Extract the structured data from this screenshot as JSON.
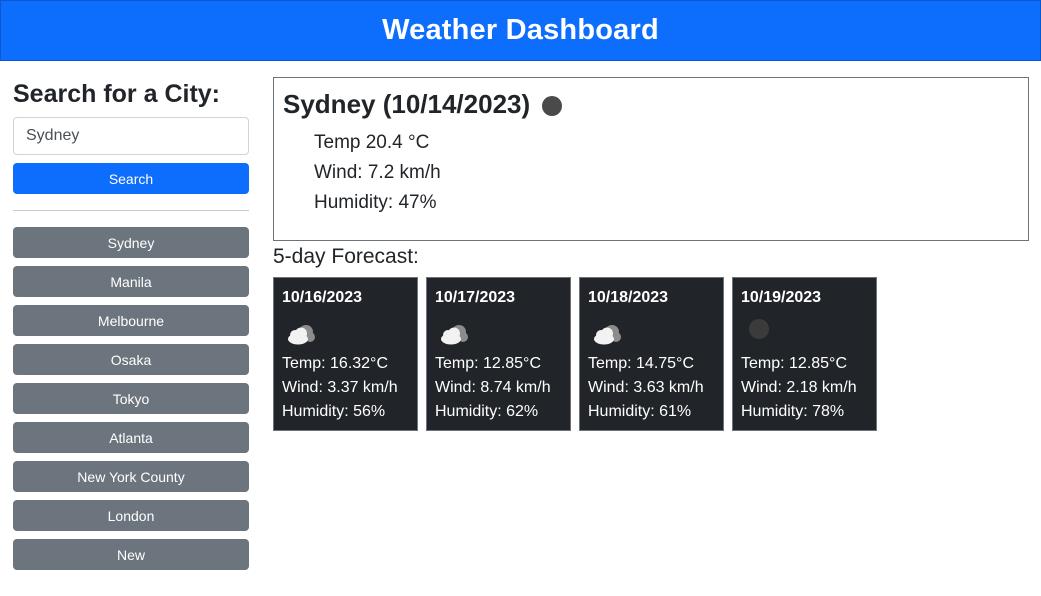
{
  "header": {
    "title": "Weather Dashboard"
  },
  "sidebar": {
    "heading": "Search for a City:",
    "search": {
      "value": "Sydney",
      "placeholder": ""
    },
    "search_button": "Search",
    "history": [
      "Sydney",
      "Manila",
      "Melbourne",
      "Osaka",
      "Tokyo",
      "Atlanta",
      "New York County",
      "London",
      "New"
    ]
  },
  "current": {
    "title": "Sydney (10/14/2023)",
    "icon": "dark-dot-icon",
    "temp": "Temp 20.4 °C",
    "wind": "Wind: 7.2 km/h",
    "humidity": "Humidity: 47%"
  },
  "forecast": {
    "heading": "5-day Forecast:",
    "days": [
      {
        "date": "10/16/2023",
        "icon": "broken-clouds-icon",
        "temp": "Temp: 16.32°C",
        "wind": "Wind: 3.37 km/h",
        "humidity": "Humidity: 56%"
      },
      {
        "date": "10/17/2023",
        "icon": "broken-clouds-icon",
        "temp": "Temp: 12.85°C",
        "wind": "Wind: 8.74 km/h",
        "humidity": "Humidity: 62%"
      },
      {
        "date": "10/18/2023",
        "icon": "broken-clouds-icon",
        "temp": "Temp: 14.75°C",
        "wind": "Wind: 3.63 km/h",
        "humidity": "Humidity: 61%"
      },
      {
        "date": "10/19/2023",
        "icon": "dark-dot-icon",
        "temp": "Temp: 12.85°C",
        "wind": "Wind: 2.18 km/h",
        "humidity": "Humidity: 78%"
      }
    ]
  },
  "colors": {
    "header": "#0d6efd",
    "secondary": "#6c757d",
    "card": "#212529"
  }
}
